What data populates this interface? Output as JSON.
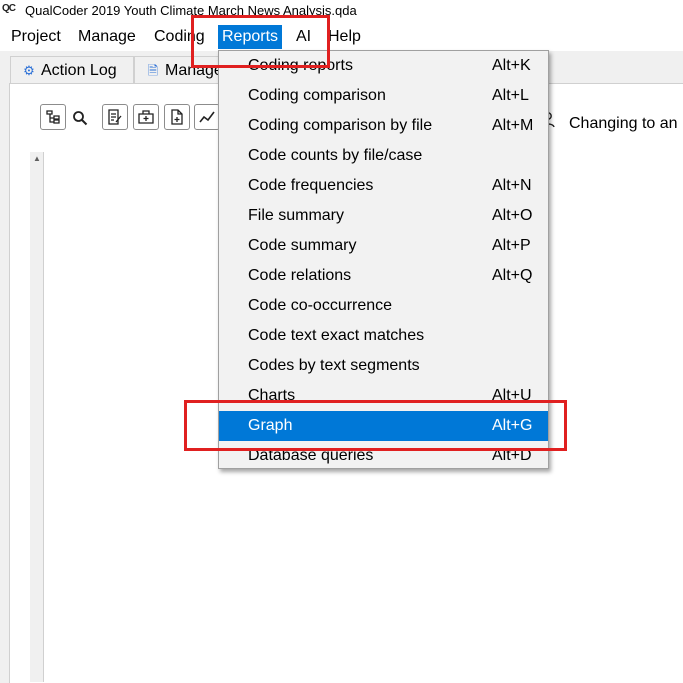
{
  "window": {
    "title": "QualCoder 2019 Youth Climate March News Analysis.qda",
    "icon": "QC"
  },
  "menubar": {
    "items": [
      "Project",
      "Manage",
      "Coding",
      "Reports",
      "AI",
      "Help"
    ],
    "active": "Reports"
  },
  "tabs": [
    {
      "label": "Action Log",
      "icon": "gear-icon"
    },
    {
      "label": "Manage",
      "icon": "file-icon"
    }
  ],
  "toolbar": {
    "status_text": "Changing to an"
  },
  "reports_menu": [
    {
      "label": "Coding reports",
      "shortcut": "Alt+K"
    },
    {
      "label": "Coding comparison",
      "shortcut": "Alt+L"
    },
    {
      "label": "Coding comparison by file",
      "shortcut": "Alt+M"
    },
    {
      "label": "Code counts by file/case",
      "shortcut": ""
    },
    {
      "label": "Code frequencies",
      "shortcut": "Alt+N"
    },
    {
      "label": "File summary",
      "shortcut": "Alt+O"
    },
    {
      "label": "Code summary",
      "shortcut": "Alt+P"
    },
    {
      "label": "Code relations",
      "shortcut": "Alt+Q"
    },
    {
      "label": "Code co-occurrence",
      "shortcut": ""
    },
    {
      "label": "Code text exact matches",
      "shortcut": ""
    },
    {
      "label": "Codes by text segments",
      "shortcut": ""
    },
    {
      "label": "Charts",
      "shortcut": "Alt+U"
    },
    {
      "label": "Graph",
      "shortcut": "Alt+G",
      "selected": true
    },
    {
      "label": "Database queries",
      "shortcut": "Alt+D"
    }
  ],
  "colors": {
    "highlight": "#0078d7",
    "annotation": "#e02020"
  }
}
